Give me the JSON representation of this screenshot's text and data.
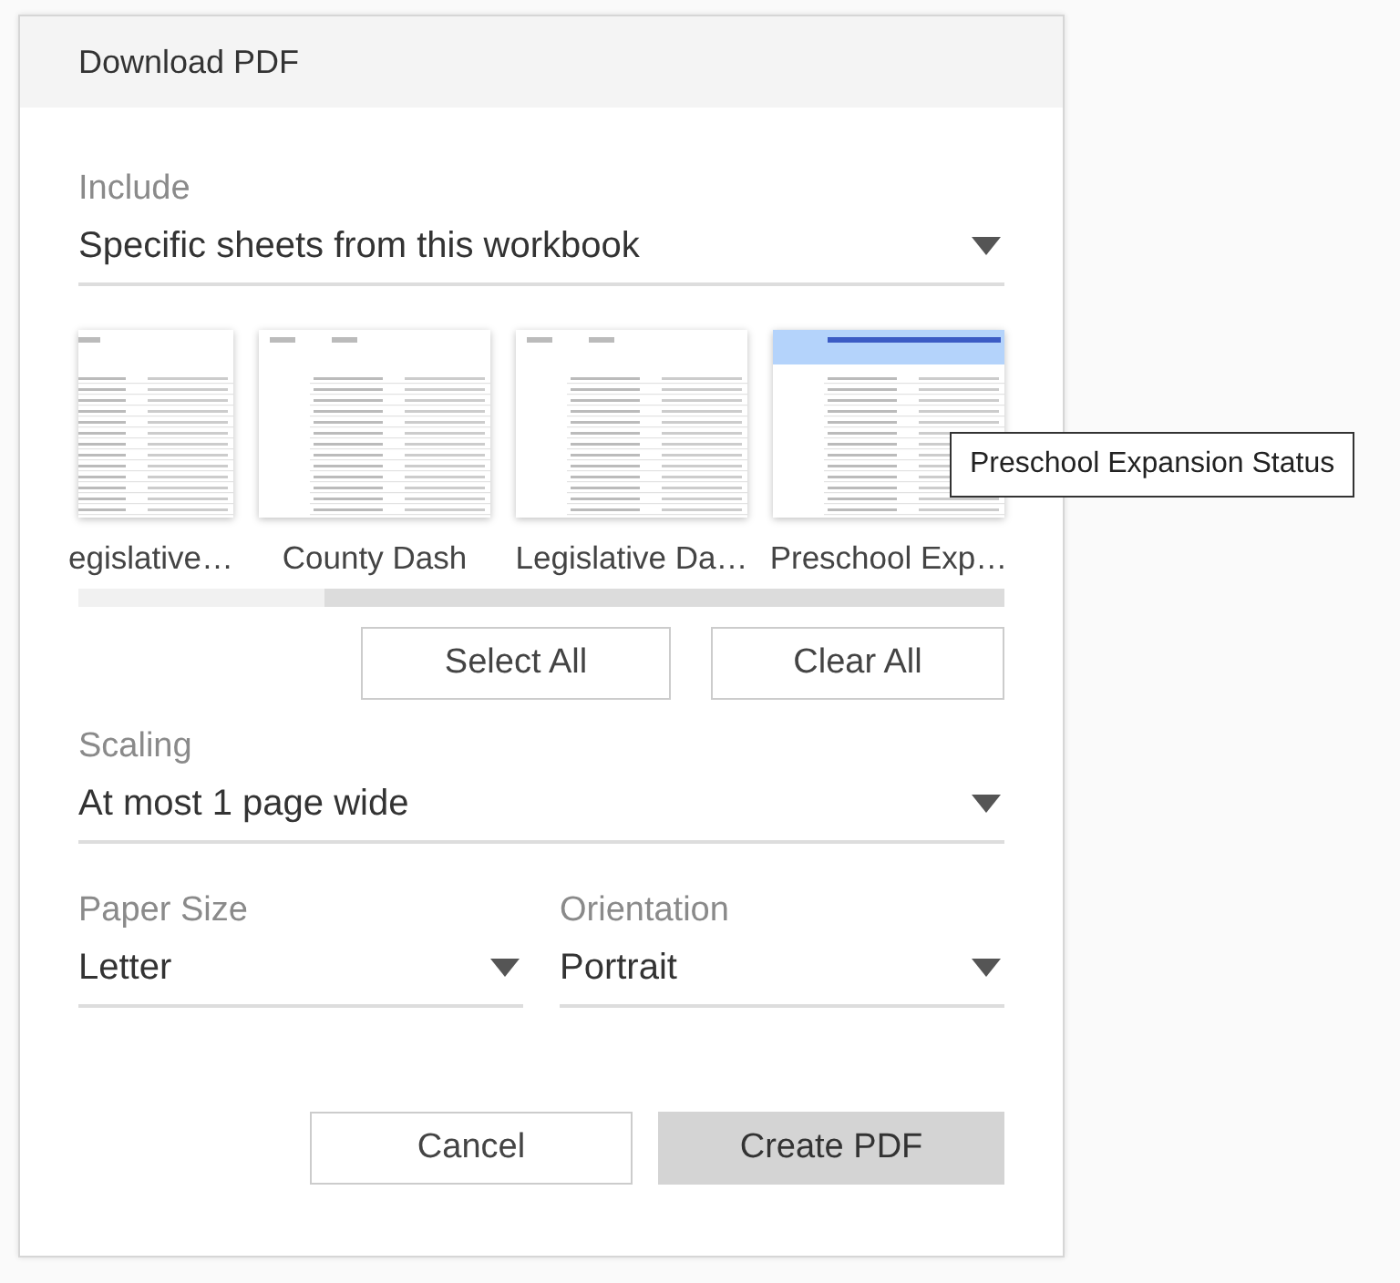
{
  "dialog": {
    "title": "Download PDF"
  },
  "include": {
    "label": "Include",
    "value": "Specific sheets from this workbook"
  },
  "sheets": [
    {
      "name": "egislative…",
      "kind": "plain"
    },
    {
      "name": "County Dash",
      "kind": "plain"
    },
    {
      "name": "Legislative Da…",
      "kind": "plain"
    },
    {
      "name": "Preschool Exp…",
      "kind": "banner"
    }
  ],
  "tooltip": "Preschool Expansion Status",
  "sheet_buttons": [
    "Select All",
    "Clear All"
  ],
  "scaling": {
    "label": "Scaling",
    "value": "At most 1 page wide"
  },
  "paper_size": {
    "label": "Paper Size",
    "value": "Letter"
  },
  "orientation": {
    "label": "Orientation",
    "value": "Portrait"
  },
  "actions": [
    {
      "label": "Cancel",
      "kind": "secondary"
    },
    {
      "label": "Create PDF",
      "kind": "primary"
    }
  ]
}
